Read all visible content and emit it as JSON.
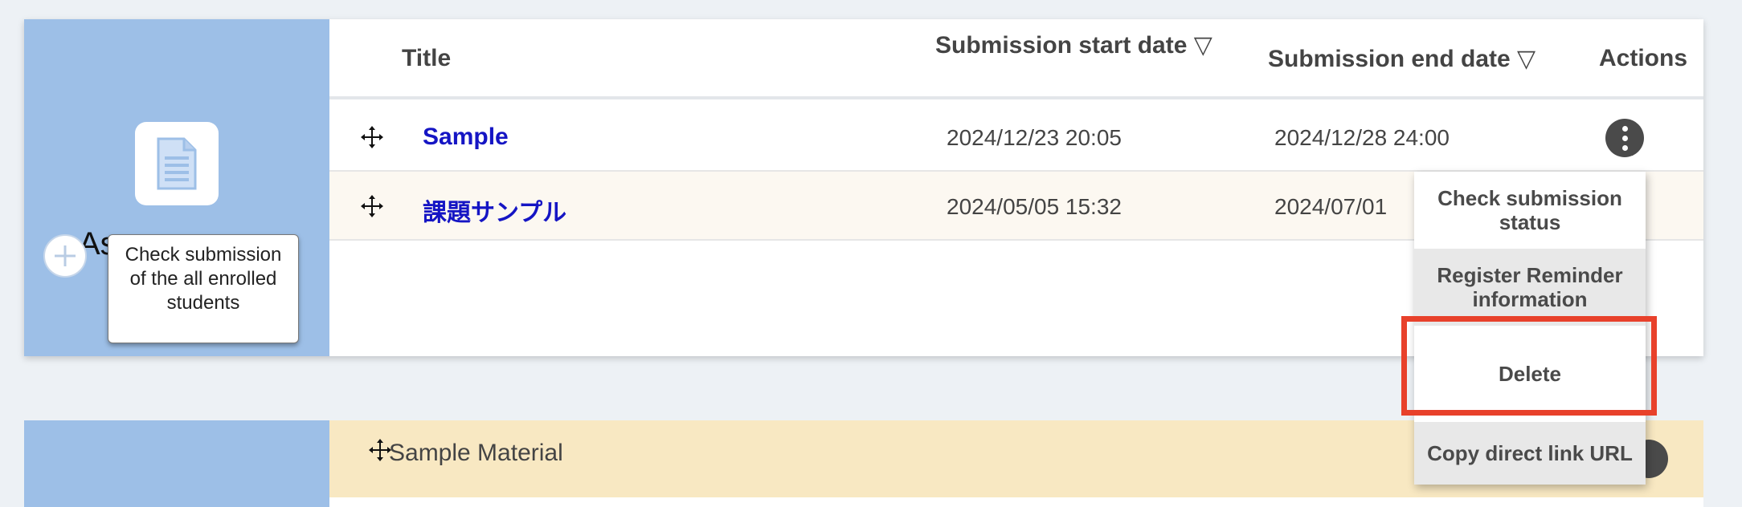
{
  "assignments": {
    "section_label": "As",
    "tooltip": "Check submission of the all enrolled students",
    "columns": {
      "title": "Title",
      "start_date": "Submission start date ▽",
      "end_date": "Submission end date ▽",
      "actions": "Actions"
    },
    "rows": [
      {
        "title": "Sample",
        "start": "2024/12/23 20:05",
        "end": "2024/12/28 24:00"
      },
      {
        "title": "課題サンプル",
        "start": "2024/05/05 15:32",
        "end": "2024/07/01"
      }
    ]
  },
  "materials": {
    "title": "Sample Material"
  },
  "action_menu": {
    "items": [
      "Check submission status",
      "Register Reminder information",
      "Delete",
      "Copy direct link URL"
    ],
    "highlighted": "Delete"
  },
  "colors": {
    "sidebar": "#9dbfe7",
    "link": "#1515c4",
    "highlight": "#e8412b"
  }
}
